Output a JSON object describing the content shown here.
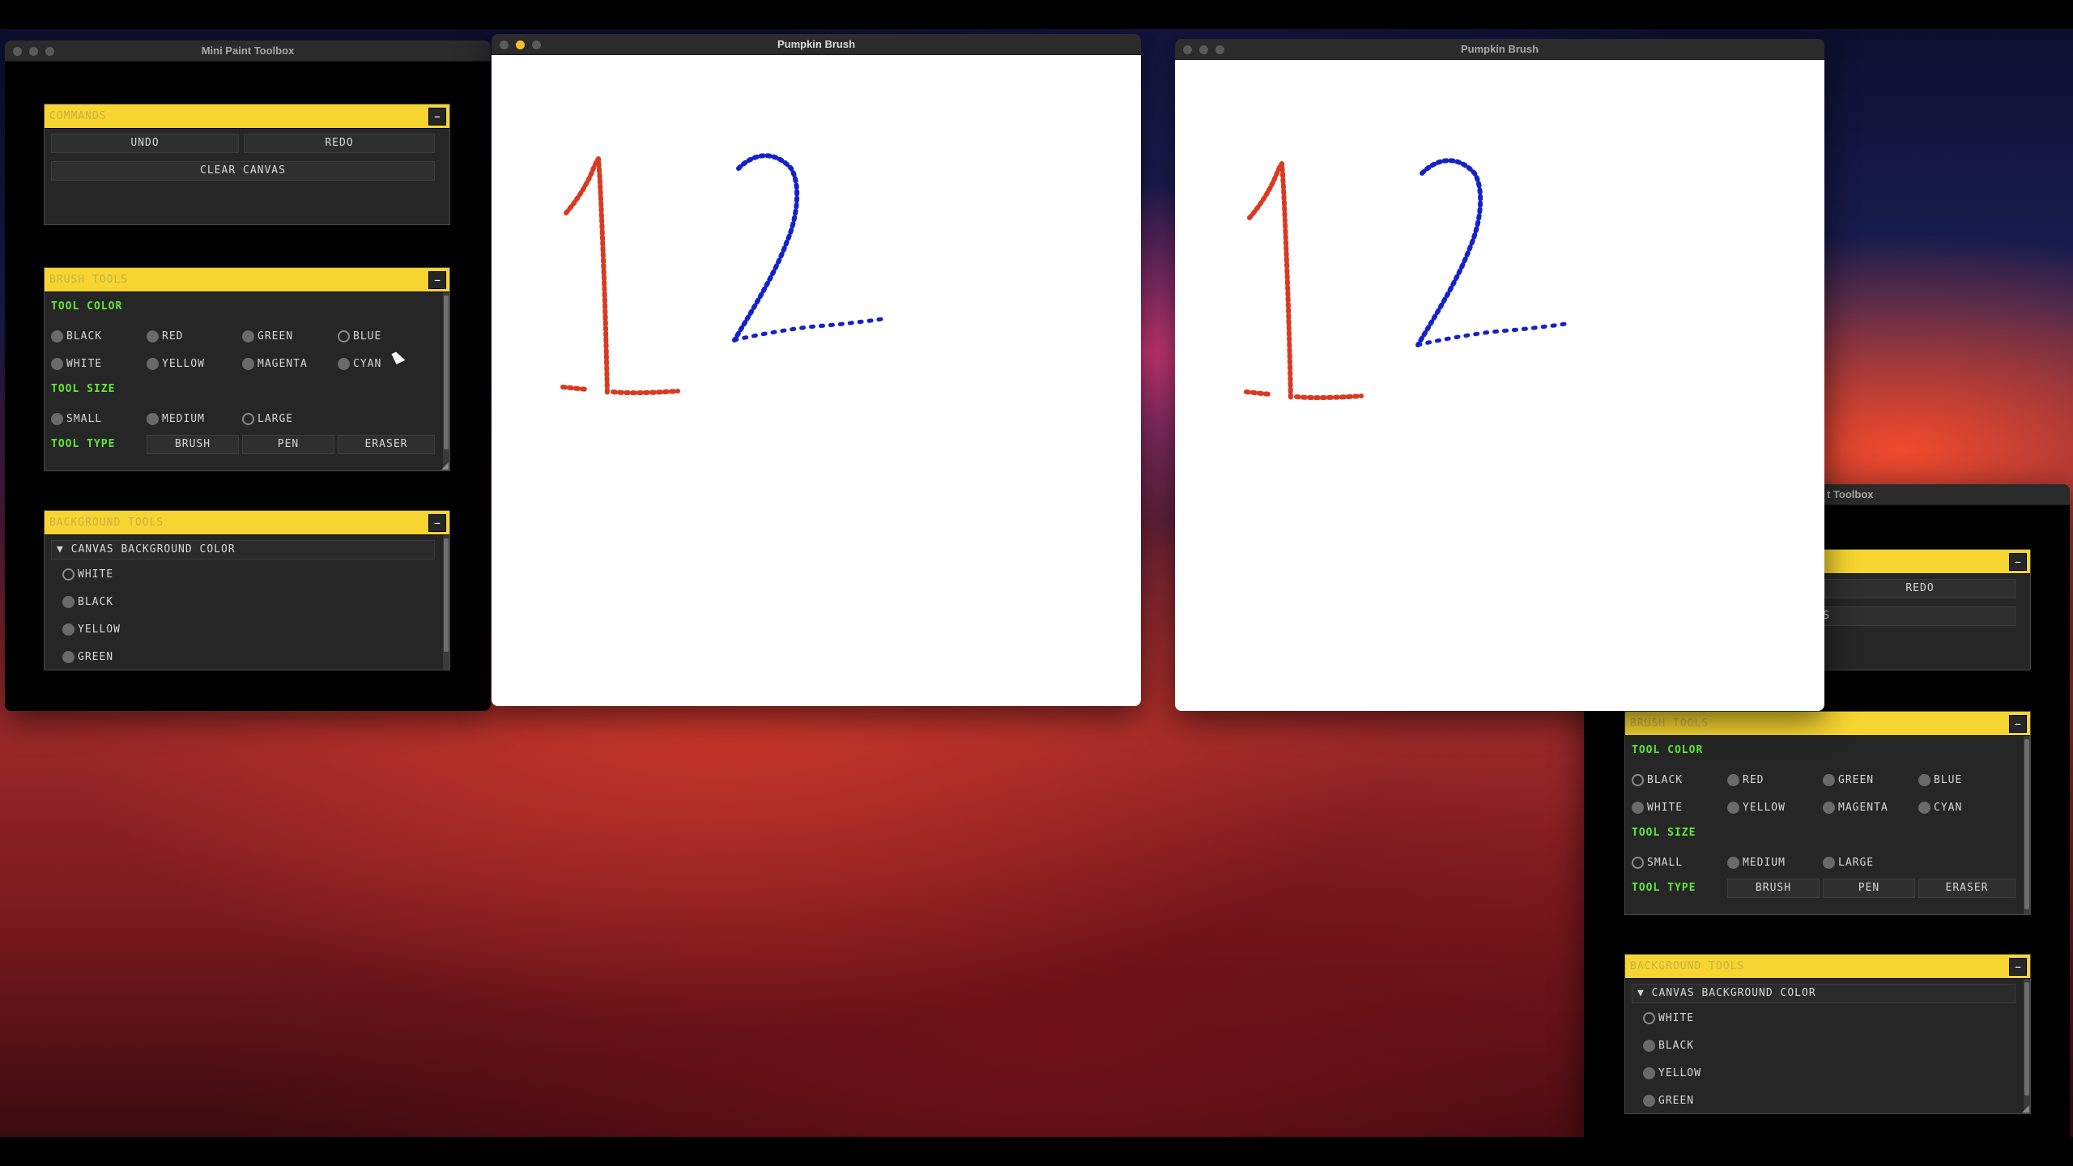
{
  "toolbox_left": {
    "title": "Mini Paint Toolbox",
    "commands": {
      "header": "Commands",
      "collapse": "–",
      "undo": "Undo",
      "redo": "Redo",
      "clear": "Clear Canvas"
    },
    "brush": {
      "header": "Brush Tools",
      "collapse": "–",
      "tool_color_label": "Tool Color",
      "colors": [
        "Black",
        "Red",
        "Green",
        "Blue",
        "White",
        "Yellow",
        "Magenta",
        "Cyan"
      ],
      "selected_color": "Blue",
      "tool_size_label": "Tool Size",
      "sizes": [
        "Small",
        "Medium",
        "Large"
      ],
      "selected_size": "Large",
      "tool_type_label": "Tool Type",
      "types": [
        "Brush",
        "Pen",
        "Eraser"
      ]
    },
    "background": {
      "header": "Background Tools",
      "collapse": "–",
      "tree_label": "▼ Canvas Background Color",
      "options": [
        "White",
        "Black",
        "Yellow",
        "Green"
      ],
      "selected": "White"
    }
  },
  "canvas_left": {
    "title": "Pumpkin Brush"
  },
  "canvas_right": {
    "title": "Pumpkin Brush"
  },
  "toolbox_right": {
    "title": "t Toolbox",
    "commands": {
      "collapse": "–",
      "redo": "Redo",
      "clear": "anvas"
    },
    "brush": {
      "header": "Brush Tools",
      "collapse": "–",
      "tool_color_label": "Tool Color",
      "colors": [
        "Black",
        "Red",
        "Green",
        "Blue",
        "White",
        "Yellow",
        "Magenta",
        "Cyan"
      ],
      "selected_color": "Black",
      "tool_size_label": "Tool Size",
      "sizes": [
        "Small",
        "Medium",
        "Large"
      ],
      "selected_size": "Small",
      "tool_type_label": "Tool Type",
      "types": [
        "Brush",
        "Pen",
        "Eraser"
      ]
    },
    "background": {
      "header": "Background Tools",
      "collapse": "–",
      "tree_label": "▼ Canvas Background Color",
      "options": [
        "White",
        "Black",
        "Yellow",
        "Green"
      ],
      "selected": "White"
    }
  },
  "colors": {
    "stroke_red": "#d83a22",
    "stroke_blue": "#1522c8",
    "panel_yellow": "#f6d530",
    "label_green": "#5fe83a"
  }
}
